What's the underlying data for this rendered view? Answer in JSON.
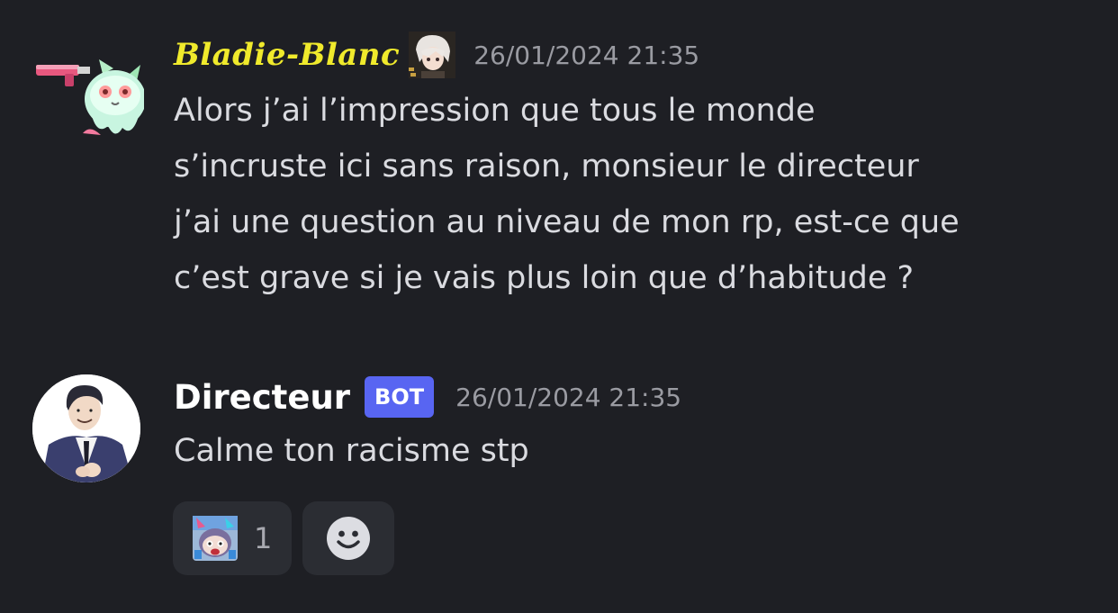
{
  "messages": [
    {
      "author": "Bladie-Blanc",
      "author_color": "#f0ea2c",
      "timestamp": "26/01/2024 21:35",
      "avatar_icon": "ghost-with-gun-avatar",
      "badge_icon": "white-haired-character-badge",
      "lines": [
        "Alors j’ai l’impression que tous le monde",
        "s’incruste ici sans raison, monsieur le directeur",
        "j’ai une question au niveau de mon rp, est-ce que",
        "c’est grave si je vais plus loin que d’habitude ?"
      ]
    },
    {
      "author": "Directeur",
      "bot_tag": "BOT",
      "bot_tag_color": "#5865f2",
      "timestamp": "26/01/2024 21:35",
      "avatar_icon": "man-in-suit-avatar",
      "text": "Calme ton racisme stp",
      "reactions": [
        {
          "emoji_icon": "anime-face-emoji",
          "count": "1"
        }
      ],
      "add_reaction_icon": "smiley-face-icon"
    }
  ]
}
